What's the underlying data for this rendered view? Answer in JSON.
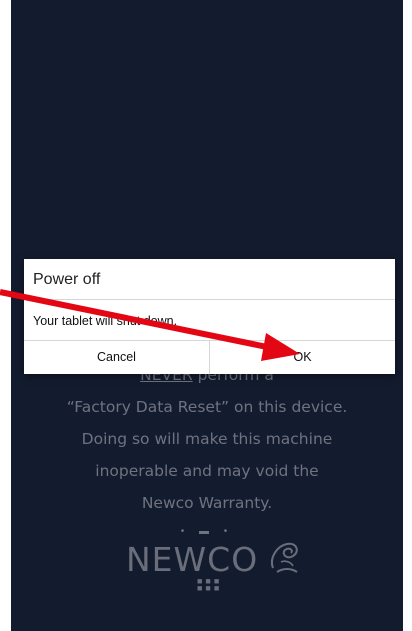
{
  "dialog": {
    "title": "Power off",
    "message": "Your tablet will shut down.",
    "cancel_label": "Cancel",
    "ok_label": "OK"
  },
  "background": {
    "warning_lines": [
      "NEVER perform a",
      "“Factory Data Reset” on this device.",
      "Doing so will make this machine",
      "inoperable and may void the",
      "Newco Warranty."
    ],
    "never_word": "NEVER",
    "line1_rest": " perform a",
    "logo_text": "NEWCO"
  },
  "colors": {
    "screen_bg": "#131b2e",
    "warning_text": "#6f7380",
    "annotation_arrow": "#e30613"
  }
}
